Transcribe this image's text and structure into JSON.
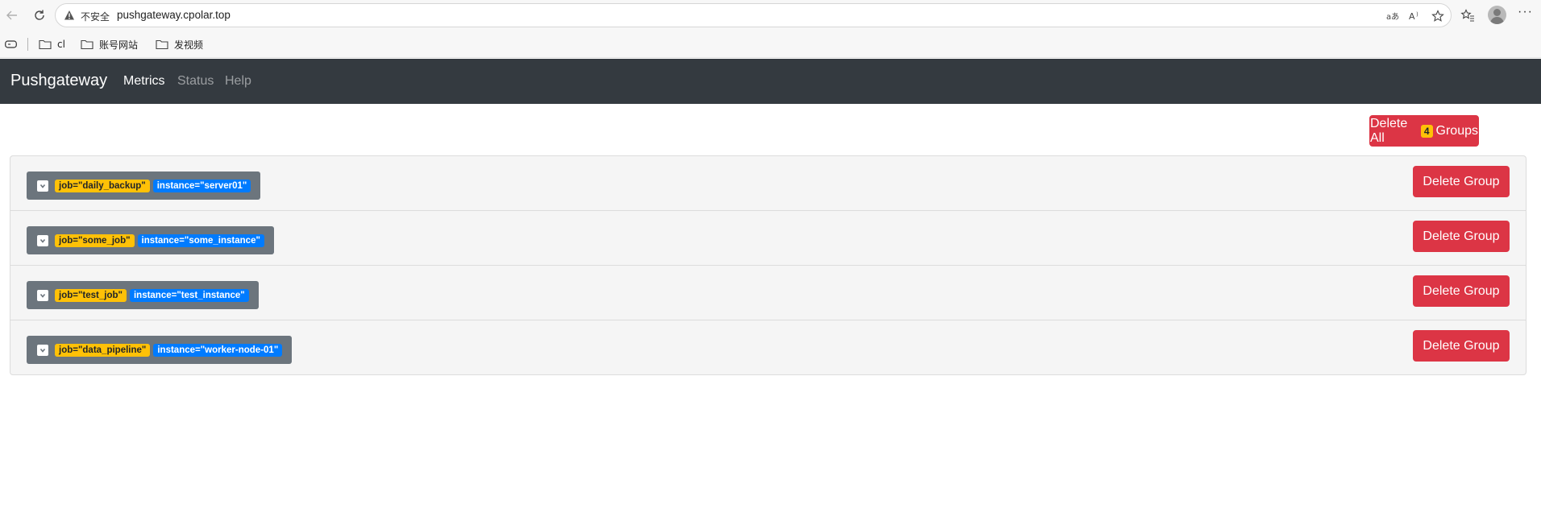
{
  "browser": {
    "insecure_label": "不安全",
    "url": "pushgateway.cpolar.top",
    "bookmarks": [
      {
        "label": "cl"
      },
      {
        "label": "账号网站"
      },
      {
        "label": "发视频"
      }
    ]
  },
  "navbar": {
    "brand": "Pushgateway",
    "links": [
      {
        "label": "Metrics",
        "active": true
      },
      {
        "label": "Status",
        "active": false
      },
      {
        "label": "Help",
        "active": false
      }
    ]
  },
  "delete_all": {
    "prefix": "Delete All",
    "count": "4",
    "suffix": "Groups"
  },
  "groups": [
    {
      "job": "job=\"daily_backup\"",
      "instance": "instance=\"server01\"",
      "button": "Delete Group"
    },
    {
      "job": "job=\"some_job\"",
      "instance": "instance=\"some_instance\"",
      "button": "Delete Group"
    },
    {
      "job": "job=\"test_job\"",
      "instance": "instance=\"test_instance\"",
      "button": "Delete Group"
    },
    {
      "job": "job=\"data_pipeline\"",
      "instance": "instance=\"worker-node-01\"",
      "button": "Delete Group"
    }
  ],
  "colors": {
    "navbar": "#343a40",
    "danger": "#dc3545",
    "job_chip": "#ffc107",
    "instance_chip": "#007bff",
    "label_box": "#6c757d"
  }
}
